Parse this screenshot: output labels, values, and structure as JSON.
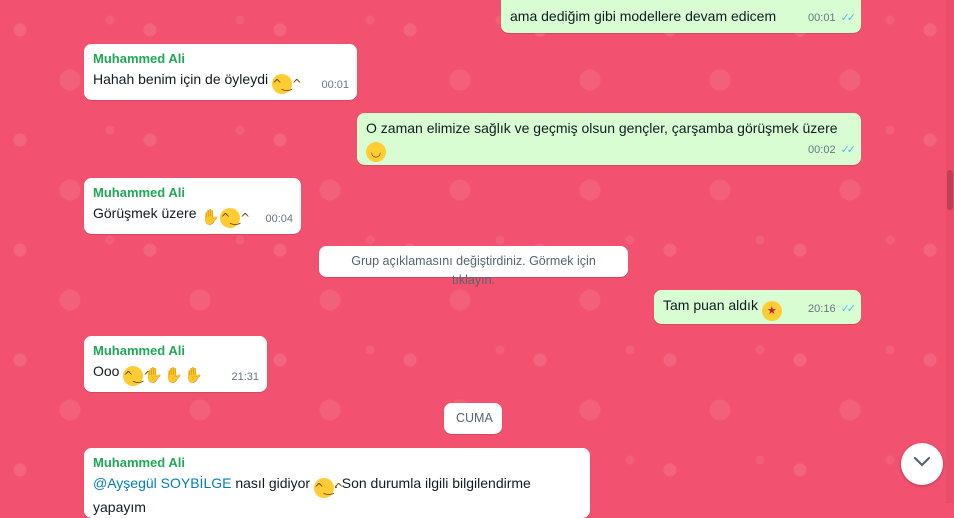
{
  "messages": [
    {
      "text": "ama dediğim gibi modellere devam edicem",
      "time": "00:01"
    },
    {
      "sender": "Muhammed Ali",
      "text": "Hahah benim için de öyleydi",
      "time": "00:01"
    },
    {
      "text_line1": "O zaman elimize sağlık ve geçmiş olsun gençler, çarşamba görüşmek üzere",
      "time": "00:02"
    },
    {
      "sender": "Muhammed Ali",
      "text": "Görüşmek üzere",
      "time": "00:04"
    },
    {
      "text": "Tam puan aldık",
      "time": "20:16"
    },
    {
      "sender": "Muhammed Ali",
      "text": "Ooo",
      "time": "21:31"
    },
    {
      "sender": "Muhammed Ali",
      "mention": "@Ayşegül SOYBİLGE",
      "text": " nasıl gidiyor ",
      "text2": ". Son durumla ilgili bilgilendirme yapayım"
    }
  ],
  "system_notice": "Grup açıklamasını değiştirdiniz. Görmek için tıklayın.",
  "date_divider": "CUMA",
  "icons": {
    "read_ticks": "double-check-icon",
    "emoji_grin": "grinning-face-icon",
    "emoji_smile": "smiling-face-icon",
    "emoji_hand": "raised-hand-icon",
    "emoji_clap": "clapping-hands-icon",
    "emoji_party": "partying-face-icon",
    "scroll_down": "chevron-down-icon"
  },
  "colors": {
    "wallpaper": "#f2526f",
    "incoming": "#ffffff",
    "outgoing": "#d9fdd3",
    "sender": "#1fa855",
    "ticks": "#53bdeb",
    "mention": "#027eb5"
  }
}
